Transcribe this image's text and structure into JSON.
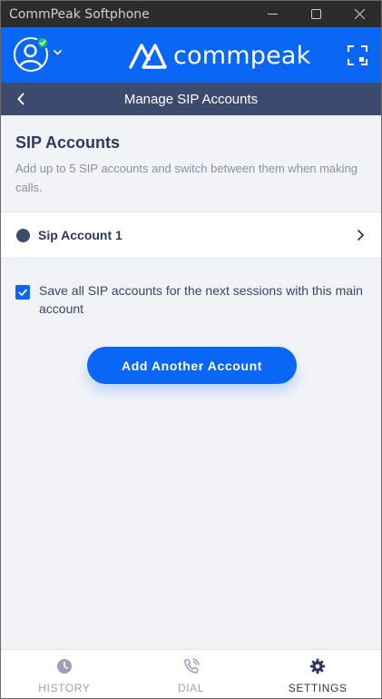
{
  "window": {
    "title": "CommPeak Softphone"
  },
  "header": {
    "brand": "commpeak",
    "user_status": "online"
  },
  "subheader": {
    "title": "Manage SIP Accounts"
  },
  "section": {
    "title": "SIP Accounts",
    "description": "Add up to 5 SIP accounts and switch between them when making calls."
  },
  "accounts": [
    {
      "name": "Sip Account 1"
    }
  ],
  "save_option": {
    "label": "Save all SIP accounts for the next sessions with this main account",
    "checked": true
  },
  "add_button": {
    "label": "Add Another Account"
  },
  "nav": {
    "items": [
      {
        "label": "HISTORY",
        "icon": "clock-icon"
      },
      {
        "label": "DIAL",
        "icon": "phone-icon"
      },
      {
        "label": "SETTINGS",
        "icon": "gear-icon"
      }
    ],
    "active": "SETTINGS"
  },
  "colors": {
    "brand_blue": "#0a66f5",
    "navy": "#3c4a6e",
    "online_green": "#22c55e"
  }
}
